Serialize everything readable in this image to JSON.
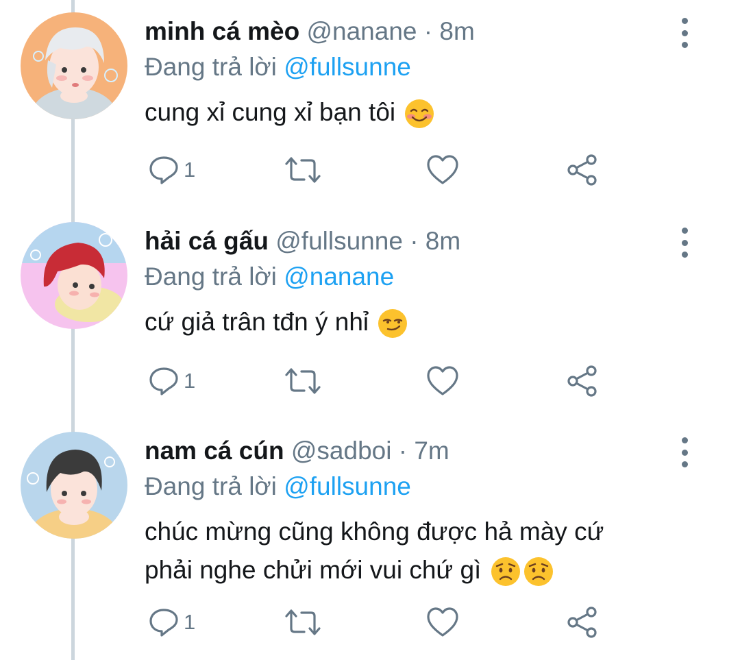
{
  "reply_prefix": "Đang trả lời",
  "colors": {
    "name": "#14171a",
    "secondary": "#657786",
    "link": "#1da1f2",
    "thread_line": "#ccd6dd"
  },
  "tweets": [
    {
      "display_name": "minh cá mèo",
      "handle": "@nanane",
      "separator": "·",
      "time": "8m",
      "reply_to": "@fullsunne",
      "text": "cung xỉ cung xỉ bạn tôi",
      "emoji": [
        "smiling-blush"
      ],
      "reply_count": "1",
      "avatar": "avatar-illustration-silver-hair"
    },
    {
      "display_name": "hải cá gấu",
      "handle": "@fullsunne",
      "separator": "·",
      "time": "8m",
      "reply_to": "@nanane",
      "text": "cứ giả trân tđn ý nhỉ",
      "emoji": [
        "smirk"
      ],
      "reply_count": "1",
      "avatar": "avatar-illustration-red-hair"
    },
    {
      "display_name": "nam cá cún",
      "handle": "@sadboi",
      "separator": "·",
      "time": "7m",
      "reply_to": "@fullsunne",
      "text_line1": "chúc mừng cũng không được hả mày cứ",
      "text_line2": "phải nghe chửi mới vui chứ gì",
      "emoji": [
        "worried",
        "worried"
      ],
      "reply_count": "1",
      "avatar": "avatar-illustration-dark-hair"
    }
  ],
  "icons": {
    "reply": "reply-bubble-icon",
    "retweet": "retweet-icon",
    "like": "heart-icon",
    "share": "share-icon",
    "more": "more-vertical-icon"
  }
}
